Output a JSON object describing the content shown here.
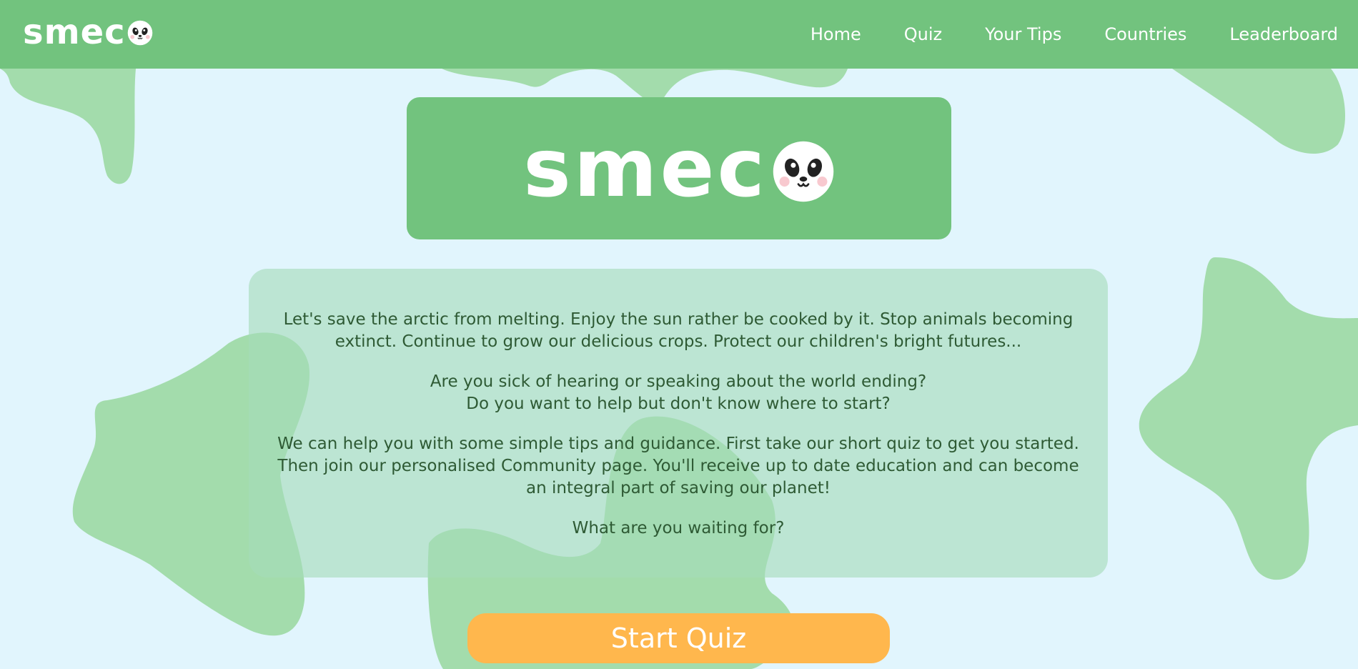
{
  "colors": {
    "background": "#e1f5fd",
    "nav": "#72c37e",
    "blob": "#a3dcac",
    "card": "#b7e3cf",
    "text": "#2e5a34",
    "button": "#ffb74d"
  },
  "brand": {
    "logo_text": "smec",
    "logo_o_icon": "panda-face-icon"
  },
  "nav": {
    "links": [
      "Home",
      "Quiz",
      "Your Tips",
      "Countries",
      "Leaderboard"
    ]
  },
  "intro": {
    "paragraphs": [
      "Let's save the arctic from melting. Enjoy the sun rather be cooked by it. Stop animals becoming extinct. Continue to grow our delicious crops. Protect our children's bright futures...",
      "Are you sick of hearing or speaking about the world ending?",
      "Do you want to help but don't know where to start?",
      "We can help you with some simple tips and guidance. First take our short quiz to get you started.",
      "Then join our personalised Community page. You'll receive up to date education and can become an integral part of saving our planet!",
      "What are you waiting for?"
    ]
  },
  "cta": {
    "label": "Start Quiz"
  }
}
